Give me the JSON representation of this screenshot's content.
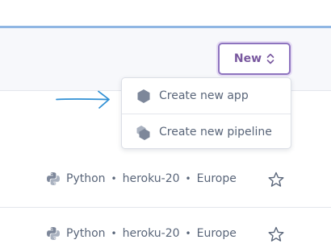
{
  "header": {
    "new_button_label": "New"
  },
  "new_menu": {
    "items": [
      {
        "label": "Create new app",
        "icon": "hexagon-icon"
      },
      {
        "label": "Create new pipeline",
        "icon": "stacked-hexagons-icon"
      }
    ]
  },
  "app_list": {
    "rows": [
      {
        "language": "Python",
        "stack": "heroku-20",
        "region": "Europe",
        "starred": false
      },
      {
        "language": "Python",
        "stack": "heroku-20",
        "region": "Europe",
        "starred": false
      }
    ]
  },
  "colors": {
    "accent": "#79589f",
    "annotation_arrow": "#2f8fd4",
    "text": "#596579",
    "icon_gray": "#7d879a"
  },
  "separator_glyph": "•"
}
